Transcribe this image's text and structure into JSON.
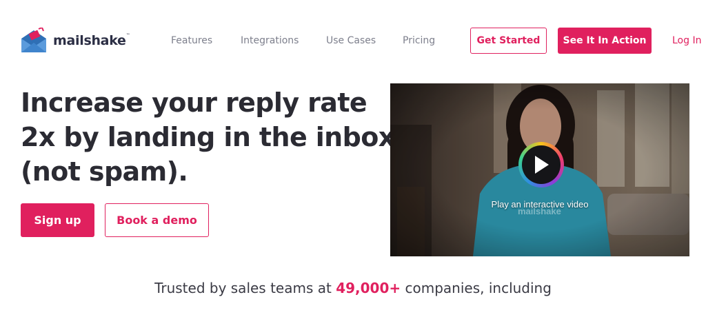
{
  "brand": {
    "name": "mailshake",
    "trademark": "™",
    "accent_color": "#e0205e",
    "logo_icon": "envelope-icon"
  },
  "nav": {
    "items": [
      {
        "label": "Features"
      },
      {
        "label": "Integrations"
      },
      {
        "label": "Use Cases"
      },
      {
        "label": "Pricing"
      }
    ],
    "get_started": "Get Started",
    "see_in_action": "See It In Action",
    "login": "Log In"
  },
  "hero": {
    "headline_lines": [
      "Increase your reply rate",
      "2x by landing in the inbox",
      "(not spam)."
    ],
    "signup_label": "Sign up",
    "demo_label": "Book a demo"
  },
  "video": {
    "caption": "Play an interactive video",
    "shirt_text": "mailshake",
    "play_icon": "play-icon"
  },
  "trusted": {
    "prefix": "Trusted by sales teams at ",
    "count": "49,000+",
    "suffix": " companies, including"
  }
}
